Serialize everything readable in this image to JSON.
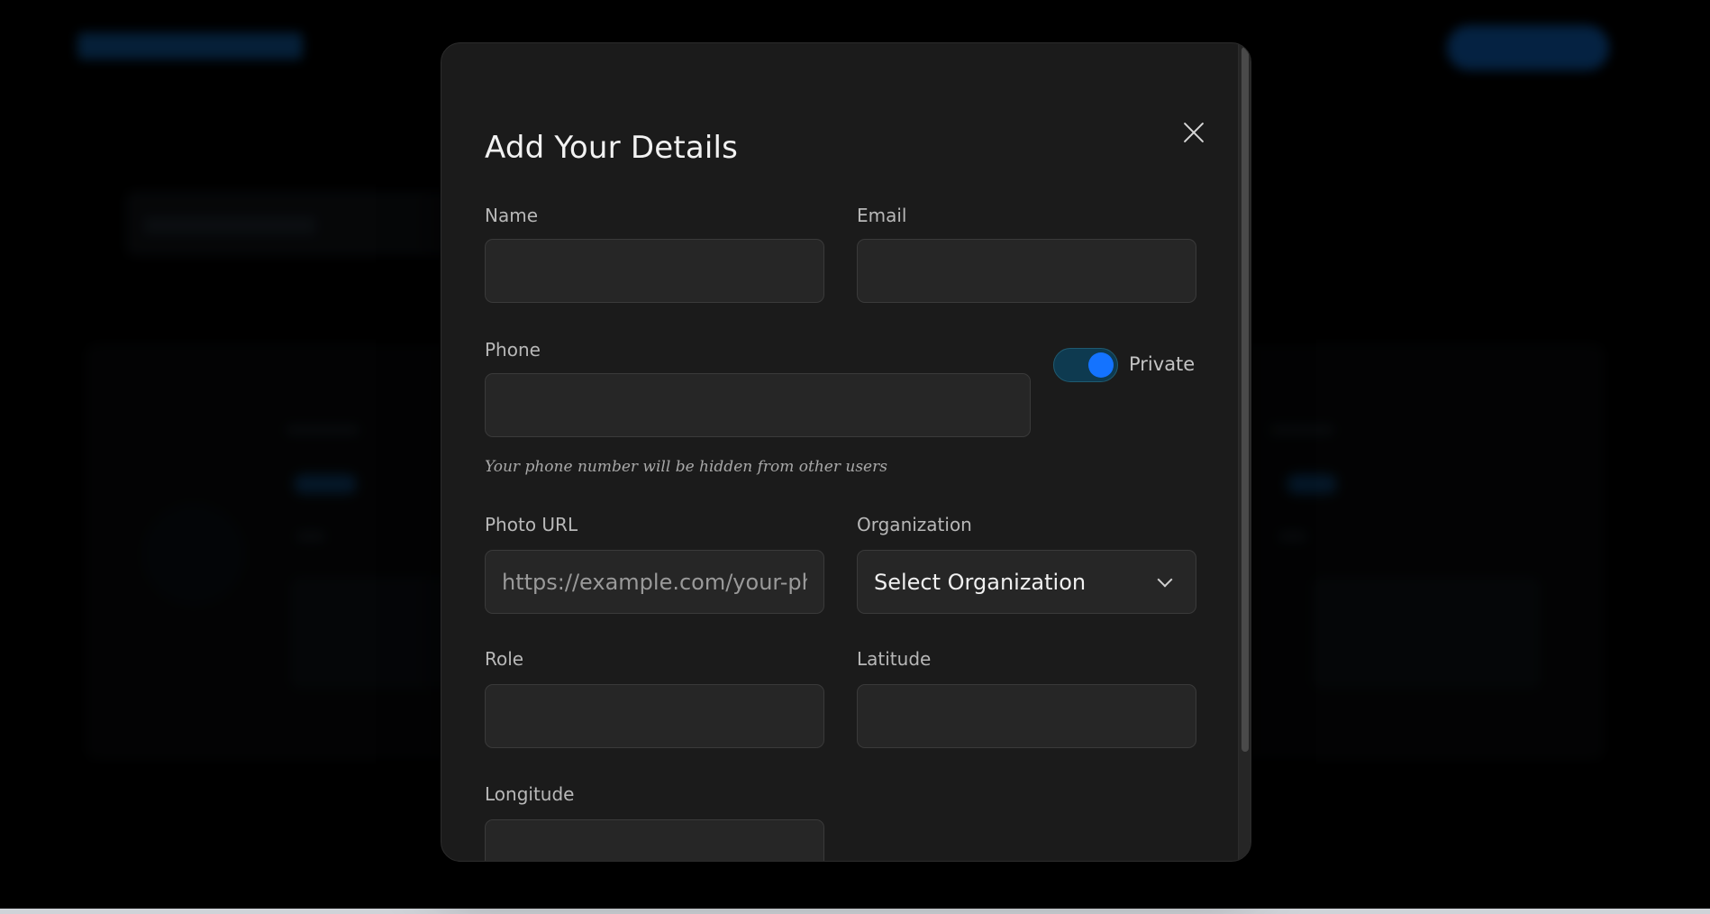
{
  "modal": {
    "title": "Add Your Details",
    "close_icon": "close-icon"
  },
  "form": {
    "name": {
      "label": "Name",
      "value": "",
      "placeholder": ""
    },
    "email": {
      "label": "Email",
      "value": "",
      "placeholder": ""
    },
    "phone": {
      "label": "Phone",
      "value": "",
      "placeholder": "",
      "private_toggle": {
        "label": "Private",
        "on": true
      },
      "helper_text": "Your phone number will be hidden from other users"
    },
    "photo_url": {
      "label": "Photo URL",
      "value": "",
      "placeholder": "https://example.com/your-photo.jpg"
    },
    "organization": {
      "label": "Organization",
      "selected": "Select Organization"
    },
    "role": {
      "label": "Role",
      "value": "",
      "placeholder": ""
    },
    "latitude": {
      "label": "Latitude",
      "value": "",
      "placeholder": ""
    },
    "longitude": {
      "label": "Longitude",
      "value": "",
      "placeholder": ""
    }
  },
  "colors": {
    "background": "#000000",
    "modal_bg": "#1b1b1b",
    "input_bg": "#262626",
    "toggle_track": "#0e3a50",
    "toggle_knob": "#1473ff"
  }
}
